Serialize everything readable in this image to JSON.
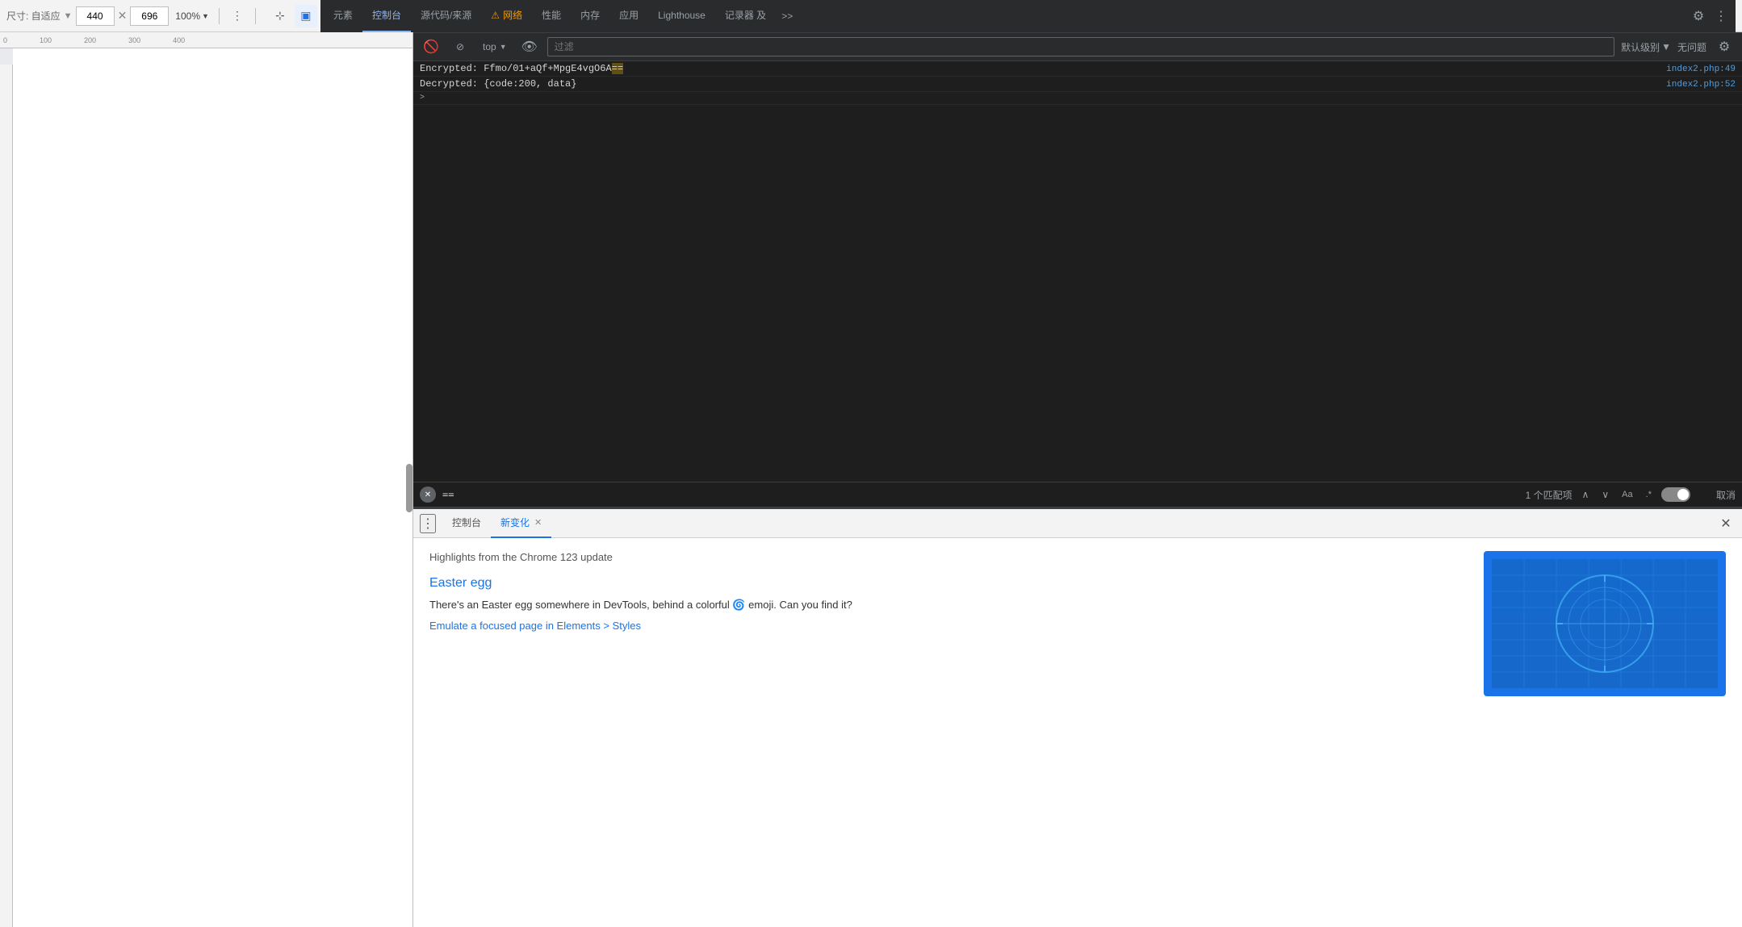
{
  "topToolbar": {
    "sizeLabel": "尺寸: 自适应",
    "width": "440",
    "height": "696",
    "zoom": "100%",
    "moreOptions": "⋮"
  },
  "tabBar": {
    "tabs": [
      {
        "id": "elements",
        "label": "元素",
        "active": false
      },
      {
        "id": "console",
        "label": "控制台",
        "active": true
      },
      {
        "id": "sources",
        "label": "源代码/来源",
        "active": false
      },
      {
        "id": "network",
        "label": "网络",
        "active": false,
        "warning": true
      },
      {
        "id": "performance",
        "label": "性能",
        "active": false
      },
      {
        "id": "memory",
        "label": "内存",
        "active": false
      },
      {
        "id": "application",
        "label": "应用",
        "active": false
      },
      {
        "id": "lighthouse",
        "label": "Lighthouse",
        "active": false
      },
      {
        "id": "recorder",
        "label": "记录器 及",
        "active": false
      }
    ],
    "more": ">>",
    "settings": "⚙",
    "moreActions": "⋮"
  },
  "consoleToolbar": {
    "contextLabel": "top",
    "filterPlaceholder": "过滤",
    "levelLabel": "默认级别",
    "levelArrow": "▼",
    "noIssues": "无问题",
    "settingsIcon": "⚙"
  },
  "consoleOutput": {
    "lines": [
      {
        "content": "Encrypted: Ffmo/01+aQf+MpgE4vgO6A==",
        "key": "Encrypted:",
        "value": "Ffmo/01+aQf+MpgE4vgO6A",
        "highlight": "==",
        "file": "index2.php:49"
      },
      {
        "content": "Decrypted: {code:200, data}",
        "key": "Decrypted:",
        "value": " {code:200, data}",
        "highlight": "",
        "file": "index2.php:52"
      }
    ],
    "expandIcon": ">"
  },
  "searchBar": {
    "value": "==",
    "matchInfo": "1 个匹配项",
    "prevBtn": "∧",
    "nextBtn": "∨",
    "caseSensitiveLabel": "Aa",
    "regexLabel": ".*",
    "cancelLabel": "取消"
  },
  "whatsNew": {
    "tabs": [
      {
        "id": "console",
        "label": "控制台",
        "active": false
      },
      {
        "id": "whats-new",
        "label": "新变化",
        "active": true,
        "closable": true
      }
    ],
    "subtitle": "Highlights from the Chrome 123 update",
    "featureTitle": "Easter egg",
    "featureDesc": "There's an Easter egg somewhere in DevTools, behind a colorful 🌀 emoji. Can you find it?",
    "featureLink": "Emulate a focused page in Elements > Styles",
    "menuIcon": "⋮",
    "closeIcon": "✕"
  }
}
